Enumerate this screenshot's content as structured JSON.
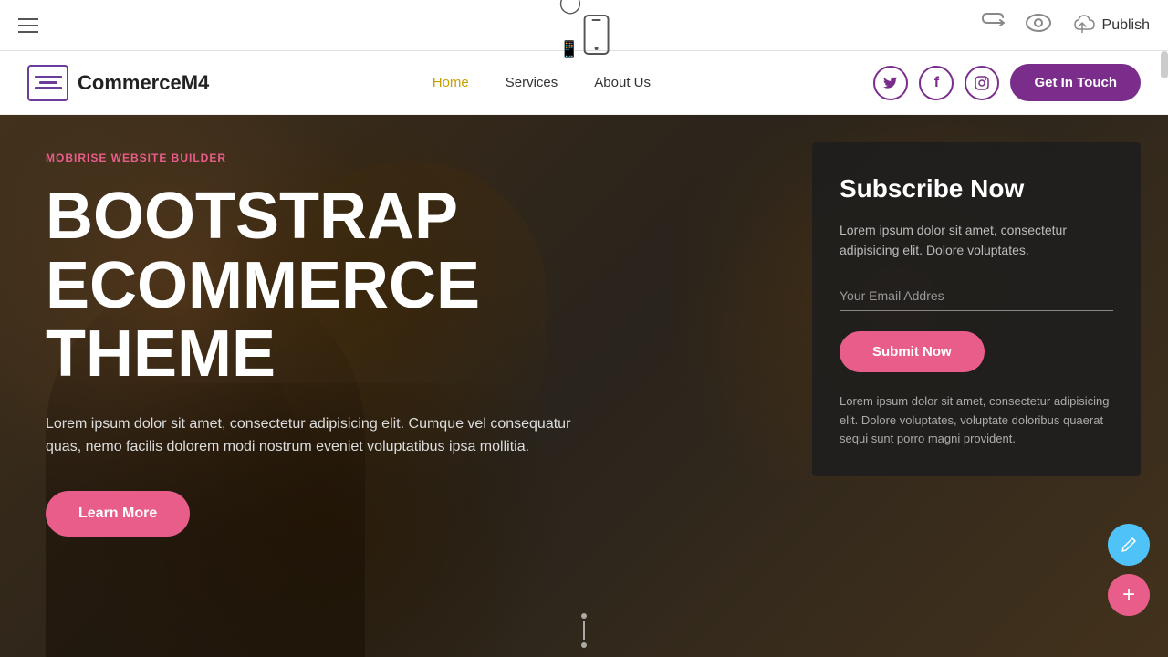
{
  "toolbar": {
    "hamburger_label": "menu",
    "phone_icon": "📱",
    "undo_icon": "↺",
    "eye_icon": "👁",
    "publish_label": "Publish",
    "cloud_icon": "☁"
  },
  "nav": {
    "logo_text": "CommerceM4",
    "links": [
      {
        "label": "Home",
        "active": true
      },
      {
        "label": "Services",
        "active": false
      },
      {
        "label": "About Us",
        "active": false
      }
    ],
    "socials": [
      "𝕏",
      "f",
      "📷"
    ],
    "cta_label": "Get In Touch"
  },
  "hero": {
    "tag": "MOBIRISE WEBSITE BUILDER",
    "title_line1": "BOOTSTRAP",
    "title_line2": "ECOMMERCE",
    "title_line3": "THEME",
    "description": "Lorem ipsum dolor sit amet, consectetur adipisicing elit. Cumque vel consequatur quas, nemo facilis dolorem modi nostrum eveniet voluptatibus ipsa mollitia.",
    "learn_more_label": "Learn More"
  },
  "subscribe": {
    "title": "Subscribe Now",
    "description": "Lorem ipsum dolor sit amet, consectetur adipisicing elit. Dolore voluptates.",
    "email_placeholder": "Your Email Addres",
    "submit_label": "Submit Now",
    "footer_text": "Lorem ipsum dolor sit amet, consectetur adipisicing elit. Dolore voluptates, voluptate doloribus quaerat sequi sunt porro magni provident."
  },
  "fabs": {
    "pencil_icon": "✏",
    "add_icon": "+"
  }
}
